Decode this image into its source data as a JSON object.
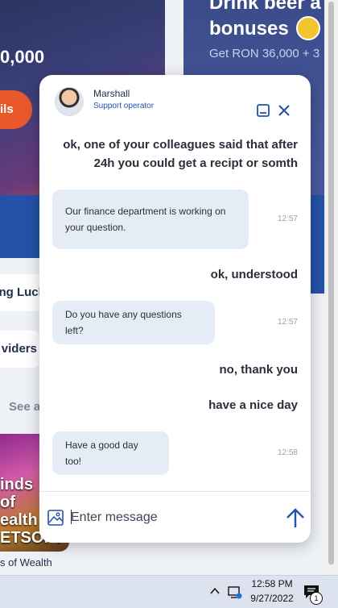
{
  "background": {
    "promo_title": "Drink beer a\nbonuses",
    "promo_subtitle": "Get RON 36,000 + 3",
    "left_amount": "0,000",
    "left_button_label": "ils",
    "side_items": [
      "ng Luck",
      "viders"
    ],
    "see_all_label": "See a",
    "game_thumb_text": "inds\nof\nealth\nETSOFT",
    "game_name": "s of Wealth"
  },
  "chat": {
    "agent_name": "Marshall",
    "agent_role": "Support operator",
    "messages": [
      {
        "from": "user",
        "text": "ok, one of your colleagues said that after"
      },
      {
        "from": "user",
        "text": "24h you could get a recipt or somth"
      },
      {
        "from": "operator",
        "text": "Our finance department is working on your question.",
        "time": "12:57"
      },
      {
        "from": "user",
        "text": "ok, understood"
      },
      {
        "from": "operator",
        "text": "Do you have any questions left?",
        "time": "12:57"
      },
      {
        "from": "user",
        "text": "no, thank you"
      },
      {
        "from": "user",
        "text": "have a nice day"
      },
      {
        "from": "operator",
        "text": "Have a good day too!",
        "time": "12:58"
      }
    ],
    "input_placeholder": "Enter message"
  },
  "taskbar": {
    "time": "12:58 PM",
    "date": "9/27/2022",
    "notification_count": "1"
  },
  "colors": {
    "accent": "#2452a8",
    "operator_bubble": "#e6ecf6",
    "cta_orange": "#e8582a"
  }
}
